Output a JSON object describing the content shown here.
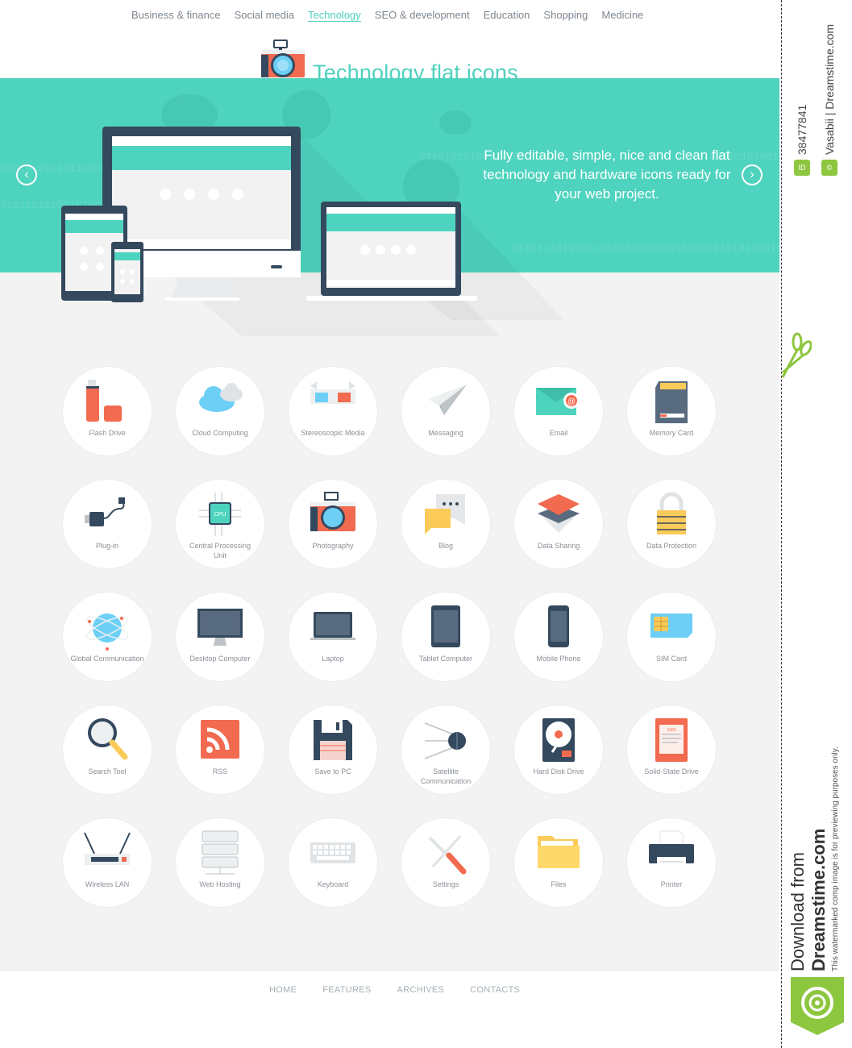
{
  "nav": {
    "items": [
      {
        "label": "Business & finance",
        "active": false
      },
      {
        "label": "Social media",
        "active": false
      },
      {
        "label": "Technology",
        "active": true
      },
      {
        "label": "SEO & development",
        "active": false
      },
      {
        "label": "Education",
        "active": false
      },
      {
        "label": "Shopping",
        "active": false
      },
      {
        "label": "Medicine",
        "active": false
      }
    ]
  },
  "header": {
    "title": "Technology flat icons",
    "logo_icon": "camera-icon"
  },
  "hero": {
    "text": "Fully editable, simple, nice and clean flat technology and hardware icons ready for your web project.",
    "prev_icon": "chevron-left-icon",
    "next_icon": "chevron-right-icon",
    "binary_rows": [
      "0110101010011010",
      "0101010101011010",
      "0101101010010101011101010",
      "0110111010100101010100101010010101010100010101011",
      "01010101001"
    ]
  },
  "icons": [
    {
      "label": "Flash Drive",
      "icon": "flash-drive-icon"
    },
    {
      "label": "Cloud Computing",
      "icon": "cloud-icon"
    },
    {
      "label": "Stereoscopic Media",
      "icon": "3d-glasses-icon"
    },
    {
      "label": "Messaging",
      "icon": "paper-plane-icon"
    },
    {
      "label": "Email",
      "icon": "envelope-icon"
    },
    {
      "label": "Memory Card",
      "icon": "sd-card-icon"
    },
    {
      "label": "Plug-in",
      "icon": "plug-icon"
    },
    {
      "label": "Central Processing Unit",
      "icon": "cpu-icon"
    },
    {
      "label": "Photography",
      "icon": "camera-icon"
    },
    {
      "label": "Blog",
      "icon": "chat-bubbles-icon"
    },
    {
      "label": "Data Sharing",
      "icon": "layers-icon"
    },
    {
      "label": "Data Protection",
      "icon": "padlock-icon"
    },
    {
      "label": "Global Communication",
      "icon": "globe-icon"
    },
    {
      "label": "Desktop Computer",
      "icon": "monitor-icon"
    },
    {
      "label": "Laptop",
      "icon": "laptop-icon"
    },
    {
      "label": "Tablet Computer",
      "icon": "tablet-icon"
    },
    {
      "label": "Mobile Phone",
      "icon": "phone-icon"
    },
    {
      "label": "SIM Card",
      "icon": "sim-card-icon"
    },
    {
      "label": "Search Tool",
      "icon": "magnifier-icon"
    },
    {
      "label": "RSS",
      "icon": "rss-icon"
    },
    {
      "label": "Save to PC",
      "icon": "floppy-disk-icon"
    },
    {
      "label": "Satellite Communication",
      "icon": "satellite-icon"
    },
    {
      "label": "Hard Disk Drive",
      "icon": "hard-disk-icon"
    },
    {
      "label": "Solid-State Drive",
      "icon": "ssd-icon"
    },
    {
      "label": "Wireless LAN",
      "icon": "router-icon"
    },
    {
      "label": "Web Hosting",
      "icon": "server-icon"
    },
    {
      "label": "Keyboard",
      "icon": "keyboard-icon"
    },
    {
      "label": "Settings",
      "icon": "tools-icon"
    },
    {
      "label": "Files",
      "icon": "folder-icon"
    },
    {
      "label": "Printer",
      "icon": "printer-icon"
    }
  ],
  "footer": {
    "links": [
      "HOME",
      "FEATURES",
      "ARCHIVES",
      "CONTACTS"
    ]
  },
  "watermark": {
    "id": "38477841",
    "credit": "Vasabii | Dreamstime.com",
    "download_line1": "Download from",
    "download_line2": "Dreamstime.com",
    "disclaimer": "This watermarked comp image is for previewing purposes only.",
    "id_badge": "ID",
    "copyright_badge": "©"
  },
  "colors": {
    "accent": "#4fd1be",
    "hero_bg": "#4ed3be",
    "page_bg": "#f3f3f3",
    "dark": "#34495e",
    "red": "#f26a4f",
    "yellow": "#fbcb5a",
    "blue": "#6dcff6",
    "watermark_green": "#8dc63f"
  }
}
